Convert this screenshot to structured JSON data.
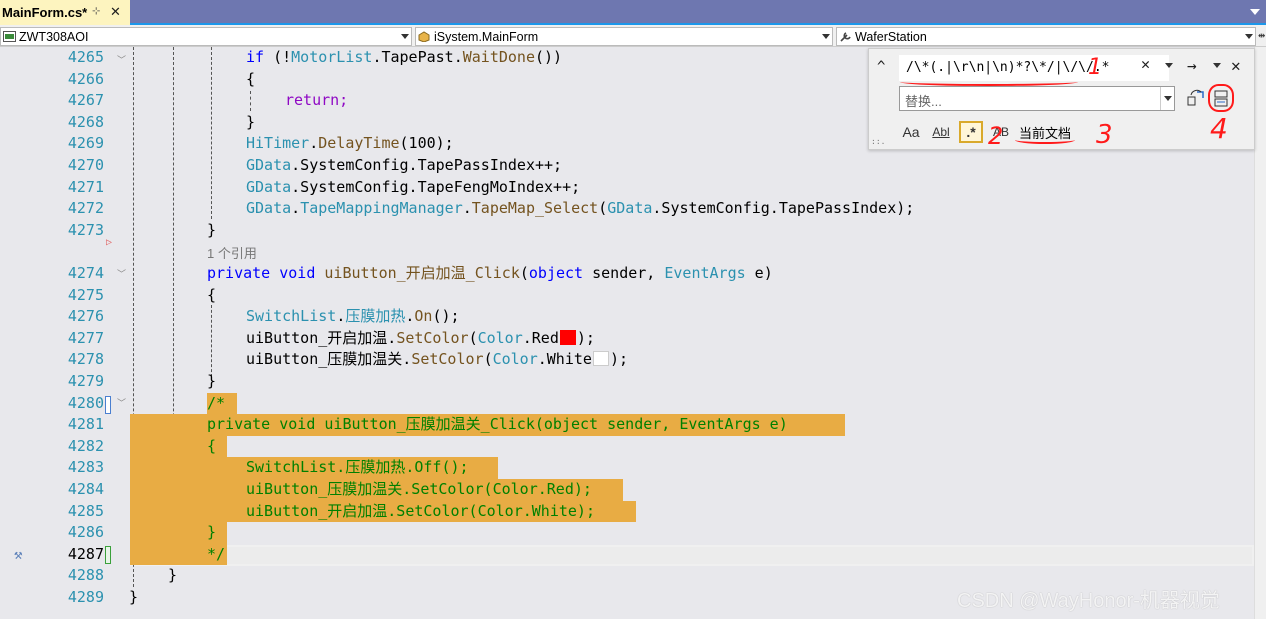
{
  "tab": {
    "title": "MainForm.cs*",
    "pin": "⊹",
    "close": "✕"
  },
  "navbar": {
    "project": "ZWT308AOI",
    "class": "iSystem.MainForm",
    "member": "WaferStation"
  },
  "findbox": {
    "toggle": "^",
    "find_value": "/\\*(.|\\r\\n|\\n)*?\\*/|\\/\\/.*",
    "clear": "✕",
    "next": "→",
    "close": "✕",
    "replace_placeholder": "替换...",
    "match_case": "Aa",
    "whole_word": "Abl",
    "regex": ".*",
    "preserve_case": "AB",
    "scope": "当前文档",
    "grip": "::."
  },
  "annotations": [
    "1",
    "2",
    "3",
    "4"
  ],
  "codelens": "1 个引用",
  "watermark": "CSDN @WayHonor-机器视觉",
  "colors": {
    "highlight": "#e8ac44",
    "keyword": "#0000ff",
    "type": "#2b91af",
    "method": "#74531f",
    "comment": "#008000",
    "annotation": "#ff1a1a"
  },
  "lines": [
    {
      "n": "4265",
      "text": "if (!MotorList.TapePast.WaitDone())"
    },
    {
      "n": "4266",
      "text": "{"
    },
    {
      "n": "4267",
      "text": "return;"
    },
    {
      "n": "4268",
      "text": "}"
    },
    {
      "n": "4269",
      "text": "HiTimer.DelayTime(100);"
    },
    {
      "n": "4270",
      "text": "GData.SystemConfig.TapePassIndex++;"
    },
    {
      "n": "4271",
      "text": "GData.SystemConfig.TapeFengMoIndex++;"
    },
    {
      "n": "4272",
      "text": "GData.TapeMappingManager.TapeMap_Select(GData.SystemConfig.TapePassIndex);"
    },
    {
      "n": "4273",
      "text": "}"
    },
    {
      "n": "4274",
      "text": "private void uiButton_开启加温_Click(object sender, EventArgs e)"
    },
    {
      "n": "4275",
      "text": "{"
    },
    {
      "n": "4276",
      "text": "SwitchList.压膜加热.On();"
    },
    {
      "n": "4277",
      "text": "uiButton_开启加温.SetColor(Color.Red);"
    },
    {
      "n": "4278",
      "text": "uiButton_压膜加温关.SetColor(Color.White);"
    },
    {
      "n": "4279",
      "text": "}"
    },
    {
      "n": "4280",
      "text": "/*"
    },
    {
      "n": "4281",
      "text": "private void uiButton_压膜加温关_Click(object sender, EventArgs e)"
    },
    {
      "n": "4282",
      "text": "{"
    },
    {
      "n": "4283",
      "text": "SwitchList.压膜加热.Off();"
    },
    {
      "n": "4284",
      "text": "uiButton_压膜加温关.SetColor(Color.Red);"
    },
    {
      "n": "4285",
      "text": "uiButton_开启加温.SetColor(Color.White);"
    },
    {
      "n": "4286",
      "text": "}"
    },
    {
      "n": "4287",
      "text": "*/"
    },
    {
      "n": "4288",
      "text": "}"
    },
    {
      "n": "4289",
      "text": "}"
    }
  ]
}
